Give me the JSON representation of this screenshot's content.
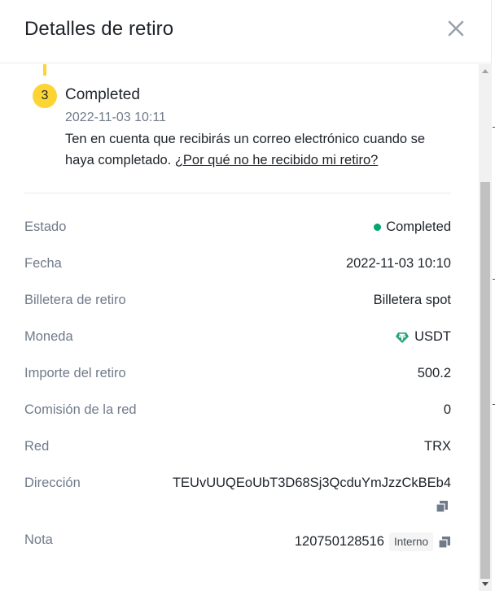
{
  "header": {
    "title": "Detalles de retiro"
  },
  "progress": {
    "step_number": "3",
    "step_title": "Completed",
    "step_date": "2022-11-03 10:11",
    "note_text": "Ten en cuenta que recibirás un correo electrónico cuando se haya completado. ",
    "note_link": "¿Por qué no he recibido mi retiro?"
  },
  "details": {
    "status": {
      "label": "Estado",
      "value": "Completed",
      "color": "#03a66d"
    },
    "date": {
      "label": "Fecha",
      "value": "2022-11-03 10:10"
    },
    "wallet": {
      "label": "Billetera de retiro",
      "value": "Billetera spot"
    },
    "coin": {
      "label": "Moneda",
      "value": "USDT",
      "icon": "tether-icon",
      "color": "#26a17b"
    },
    "amount": {
      "label": "Importe del retiro",
      "value": "500.2"
    },
    "fee": {
      "label": "Comisión de la red",
      "value": "0"
    },
    "network": {
      "label": "Red",
      "value": "TRX"
    },
    "address": {
      "label": "Dirección",
      "value": "TEUvUUQEoUbT3D68Sj3QcduYmJzzCkBEb4"
    },
    "note": {
      "label": "Nota",
      "value": "120750128516",
      "badge": "Interno"
    }
  },
  "colors": {
    "accent": "#fcd535",
    "text": "#1e2329",
    "muted": "#707a8a"
  }
}
